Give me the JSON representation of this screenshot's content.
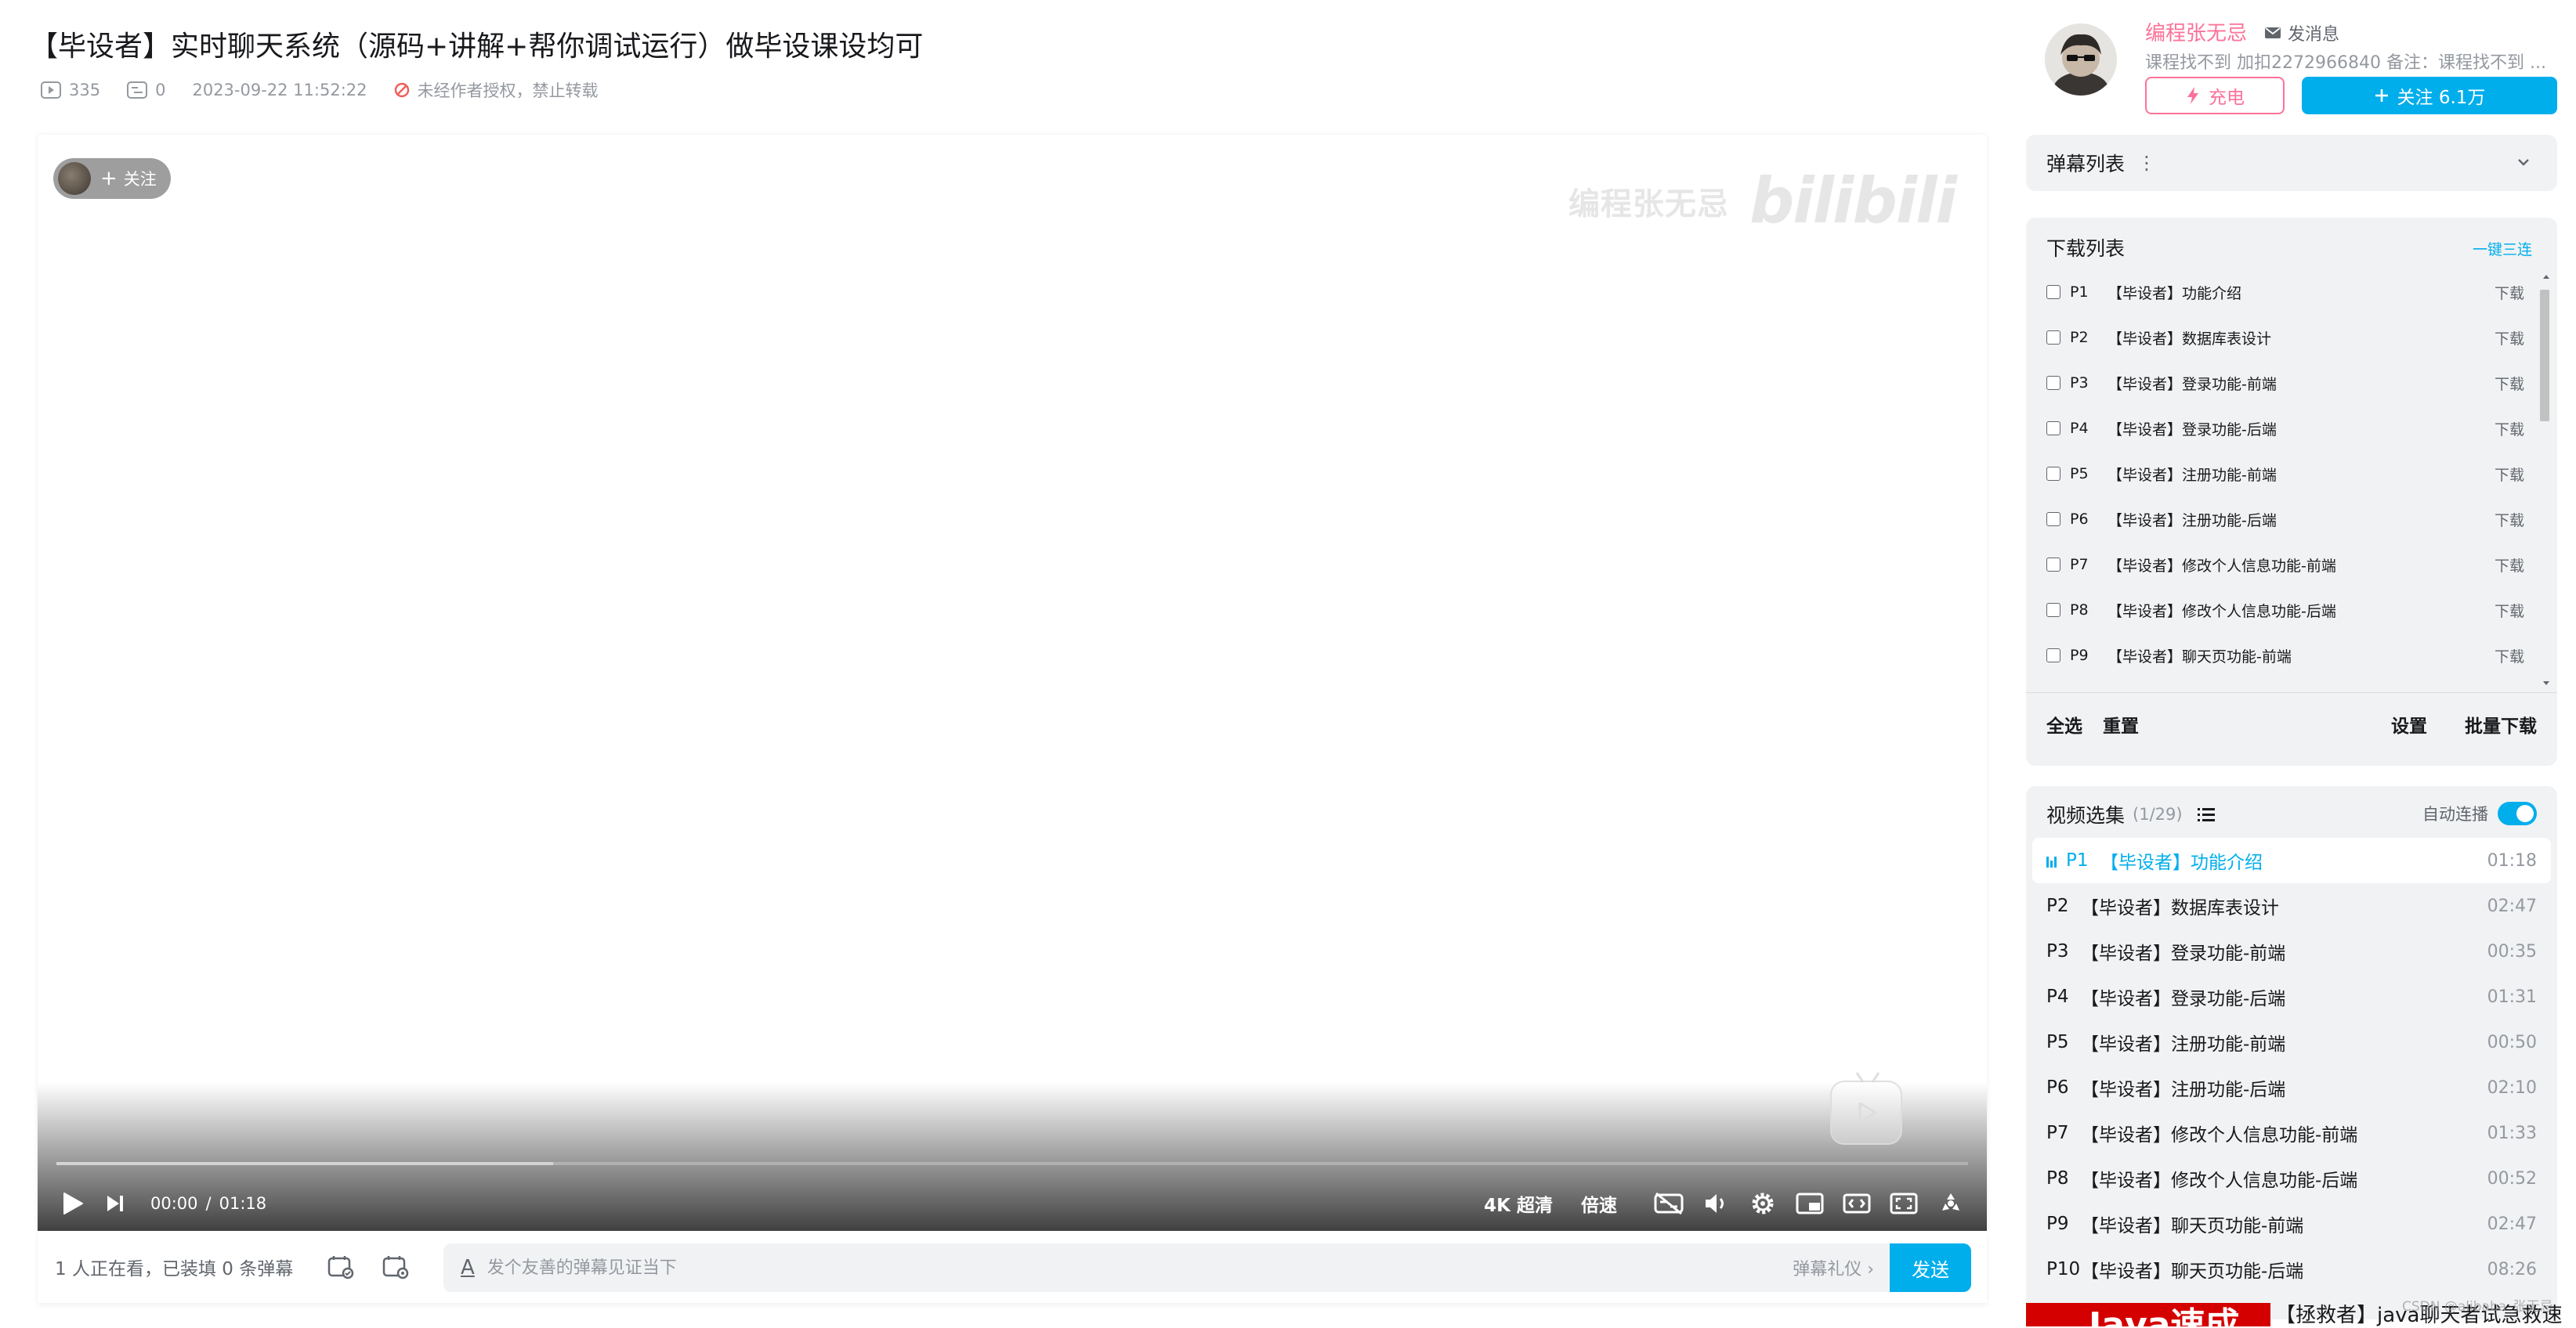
{
  "video": {
    "title": "【毕设者】实时聊天系统（源码+讲解+帮你调试运行）做毕设课设均可",
    "plays": "335",
    "danmaku_count": "0",
    "publish_time": "2023-09-22 11:52:22",
    "copyright_notice": "未经作者授权，禁止转载"
  },
  "player": {
    "follow_chip_label": "关注",
    "watermark_text": "编程张无忌",
    "watermark_logo": "bilibili",
    "current_time": "00:00",
    "time_separator": "/",
    "total_time": "01:18",
    "progress_loaded": 0.26,
    "quality_label": "4K 超清",
    "speed_label": "倍速"
  },
  "danmaku_bar": {
    "viewer_status": "1 人正在看，已装填 0 条弹幕",
    "input_placeholder": "发个友善的弹幕见证当下",
    "etiquette_label": "弹幕礼仪 ›",
    "send_label": "发送"
  },
  "uploader": {
    "name": "编程张无忌",
    "message_label": "发消息",
    "description": "课程找不到 加扣2272966840 备注：课程找不到 ...",
    "charge_label": "充电",
    "follow_label": "关注 6.1万"
  },
  "danmaku_list": {
    "title": "弹幕列表"
  },
  "download": {
    "title": "下载列表",
    "triple_label": "一键三连",
    "action_label": "下载",
    "items": [
      {
        "p": "P1",
        "title": "【毕设者】功能介绍"
      },
      {
        "p": "P2",
        "title": "【毕设者】数据库表设计"
      },
      {
        "p": "P3",
        "title": "【毕设者】登录功能-前端"
      },
      {
        "p": "P4",
        "title": "【毕设者】登录功能-后端"
      },
      {
        "p": "P5",
        "title": "【毕设者】注册功能-前端"
      },
      {
        "p": "P6",
        "title": "【毕设者】注册功能-后端"
      },
      {
        "p": "P7",
        "title": "【毕设者】修改个人信息功能-前端"
      },
      {
        "p": "P8",
        "title": "【毕设者】修改个人信息功能-后端"
      },
      {
        "p": "P9",
        "title": "【毕设者】聊天页功能-前端"
      },
      {
        "p": "P10",
        "title": "【毕设者】聊天页功能-后端"
      }
    ],
    "select_all_label": "全选",
    "reset_label": "重置",
    "settings_label": "设置",
    "batch_download_label": "批量下载"
  },
  "episodes": {
    "title": "视频选集",
    "count": "(1/29)",
    "autoplay_label": "自动连播",
    "autoplay_on": true,
    "items": [
      {
        "p": "P1",
        "title": "【毕设者】功能介绍",
        "duration": "01:18",
        "active": true
      },
      {
        "p": "P2",
        "title": "【毕设者】数据库表设计",
        "duration": "02:47"
      },
      {
        "p": "P3",
        "title": "【毕设者】登录功能-前端",
        "duration": "00:35"
      },
      {
        "p": "P4",
        "title": "【毕设者】登录功能-后端",
        "duration": "01:31"
      },
      {
        "p": "P5",
        "title": "【毕设者】注册功能-前端",
        "duration": "00:50"
      },
      {
        "p": "P6",
        "title": "【毕设者】注册功能-后端",
        "duration": "02:10"
      },
      {
        "p": "P7",
        "title": "【毕设者】修改个人信息功能-前端",
        "duration": "01:33"
      },
      {
        "p": "P8",
        "title": "【毕设者】修改个人信息功能-后端",
        "duration": "00:52"
      },
      {
        "p": "P9",
        "title": "【毕设者】聊天页功能-前端",
        "duration": "02:47"
      },
      {
        "p": "P10",
        "title": "【毕设者】聊天页功能-后端",
        "duration": "08:26"
      }
    ]
  },
  "ad": {
    "banner_text": "Java速成",
    "title": "【拯救者】java聊天者试急救速"
  },
  "csdn_watermark": "CSDN @alibaba_张无忌",
  "colors": {
    "accent": "#00aeec",
    "pink": "#fb7299",
    "text": "#18191c",
    "muted": "#9499a0"
  }
}
